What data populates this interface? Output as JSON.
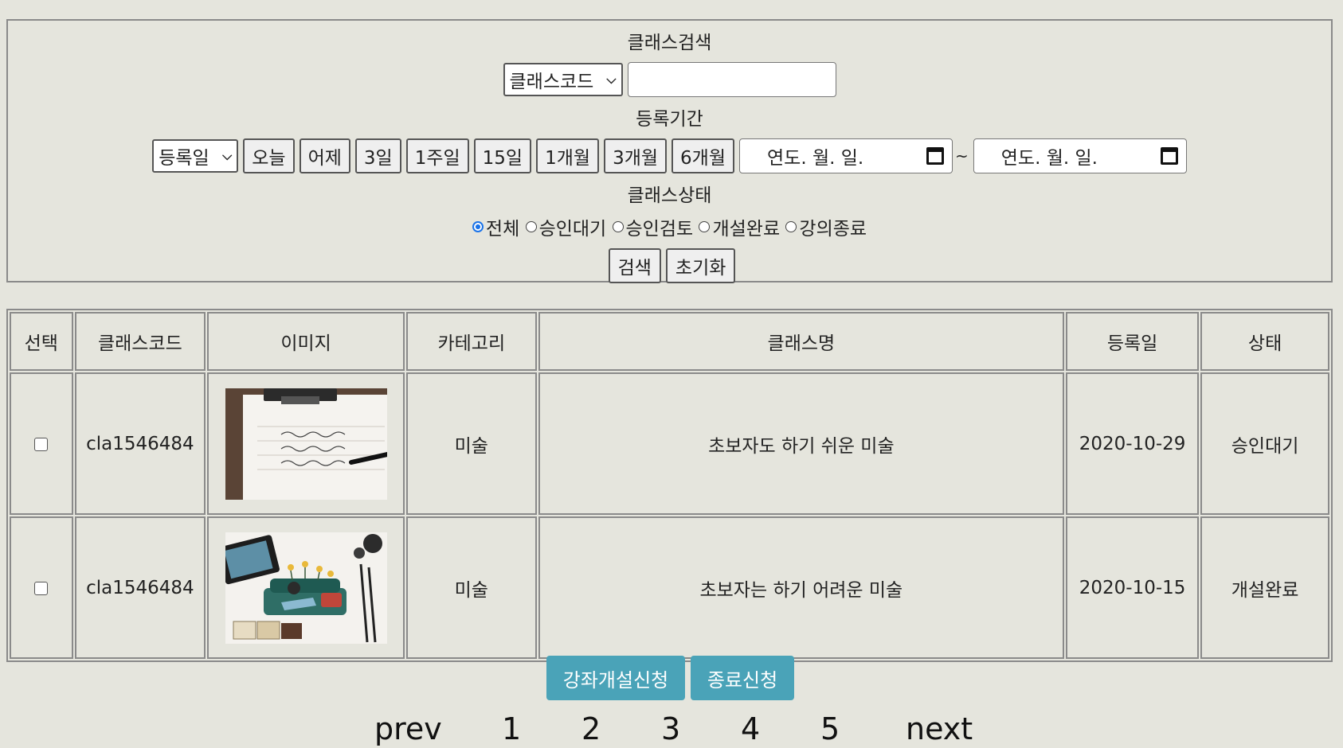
{
  "search": {
    "class_search_label": "클래스검색",
    "class_field_select": "클래스코드",
    "keyword_value": "",
    "period_label": "등록기간",
    "date_field_select": "등록일",
    "period_buttons": [
      "오늘",
      "어제",
      "3일",
      "1주일",
      "15일",
      "1개월",
      "3개월",
      "6개월"
    ],
    "date_from_placeholder": "연도. 월. 일.",
    "date_to_placeholder": "연도. 월. 일.",
    "date_separator": "~",
    "status_label": "클래스상태",
    "status_options": [
      "전체",
      "승인대기",
      "승인검토",
      "개설완료",
      "강의종료"
    ],
    "status_selected": "전체",
    "search_button": "검색",
    "reset_button": "초기화"
  },
  "table": {
    "headers": [
      "선택",
      "클래스코드",
      "이미지",
      "카테고리",
      "클래스명",
      "등록일",
      "상태"
    ],
    "rows": [
      {
        "code": "cla1546484",
        "image": "calligraphy-clipboard",
        "category": "미술",
        "name": "초보자도 하기 쉬운 미술",
        "date": "2020-10-29",
        "status": "승인대기"
      },
      {
        "code": "cla1546484",
        "image": "illustration-sofa",
        "category": "미술",
        "name": "초보자는 하기 어려운 미술",
        "date": "2020-10-15",
        "status": "개설완료"
      }
    ]
  },
  "actions": {
    "open_request": "강좌개설신청",
    "close_request": "종료신청",
    "accent": "#4aa3b8"
  },
  "pager": {
    "prev": "prev",
    "pages": [
      "1",
      "2",
      "3",
      "4",
      "5"
    ],
    "next": "next"
  }
}
